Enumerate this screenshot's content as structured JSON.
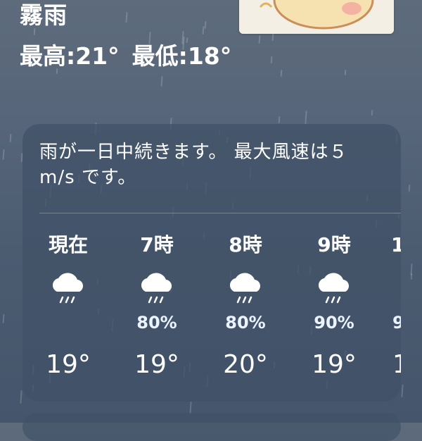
{
  "header": {
    "condition": "霧雨",
    "high": "最高:21°",
    "low": "最低:18°"
  },
  "forecast": {
    "summary": "雨が一日中続きます。 最大風速は５ m/s です。",
    "hours": [
      {
        "label": "現在",
        "icon": "rain-cloud-icon",
        "pop": "",
        "temp": "19°"
      },
      {
        "label": "7時",
        "icon": "rain-cloud-icon",
        "pop": "80%",
        "temp": "19°"
      },
      {
        "label": "8時",
        "icon": "rain-cloud-icon",
        "pop": "80%",
        "temp": "20°"
      },
      {
        "label": "9時",
        "icon": "rain-cloud-icon",
        "pop": "90%",
        "temp": "19°"
      },
      {
        "label": "1",
        "icon": "rain-cloud-icon",
        "pop": "9",
        "temp": "1"
      }
    ]
  }
}
